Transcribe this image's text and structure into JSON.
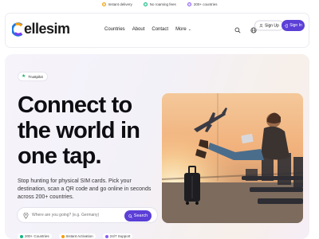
{
  "topbar": {
    "perks": [
      "Instant delivery",
      "No roaming fees",
      "200+ countries"
    ],
    "colors": [
      "#f59e0b",
      "#10b981",
      "#8b5cf6"
    ]
  },
  "brand": {
    "name": "ellesim",
    "accent": "#5b3fd6"
  },
  "nav": {
    "links": [
      "Countries",
      "About",
      "Contact",
      "More"
    ],
    "signup": "Sign Up",
    "signin": "Sign In"
  },
  "hero": {
    "trust_label": "Trustpilot",
    "headline": "Connect to the world in one tap.",
    "subtitle": "Stop hunting for physical SIM cards. Pick your destination, scan a QR code and go online in seconds across 200+ countries.",
    "search_placeholder": "Where are you going? (e.g. Germany)",
    "search_button": "Search",
    "badges": [
      "200+ Countries",
      "Instant Activation",
      "24/7 Support"
    ]
  },
  "icons": [
    "search-icon",
    "globe-icon",
    "user-icon",
    "login-icon",
    "chevron-down-icon",
    "star-icon",
    "pin-icon"
  ]
}
